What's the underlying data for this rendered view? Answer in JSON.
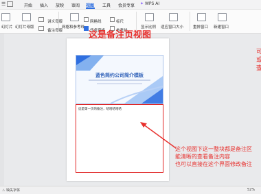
{
  "menu": {
    "file_icon": "hamburger-icon",
    "items": [
      "开始",
      "插入",
      "放映",
      "审阅",
      "视图",
      "工具",
      "会员专享"
    ],
    "active": "视图",
    "wps_ai": "WPS AI"
  },
  "ribbon": {
    "first": "幻灯片",
    "slide_master": "幻灯片母版",
    "lecture_master": "讲义母版",
    "notes_master": "备注母版",
    "grid_guides": "网格和参考线",
    "checks": [
      {
        "label": "网格线",
        "checked": false
      },
      {
        "label": "标尺",
        "checked": false
      },
      {
        "label": "任务窗格",
        "checked": true
      },
      {
        "label": "参考线",
        "checked": false
      }
    ],
    "zoom": "显示比例",
    "fit_window": "适应窗口大小",
    "rearrange": "重排窗口",
    "new_window": "新建窗口"
  },
  "heading": "这是备注页视图",
  "slide": {
    "title": "蓝色简约公司简介模板"
  },
  "notes": {
    "text": "这是第一页的备注，哈哈哈哈哈"
  },
  "side_text": [
    "可",
    "或",
    "查"
  ],
  "annotation": [
    "这个视图下这一整块都是备注区",
    "能清晰的查看备注内容",
    "也可以直接在这个界面修改备注"
  ],
  "status": {
    "left": "缺失字体",
    "zoom": "52%"
  },
  "colors": {
    "accent_red": "#e8312e",
    "accent_blue": "#2f6fe0"
  }
}
